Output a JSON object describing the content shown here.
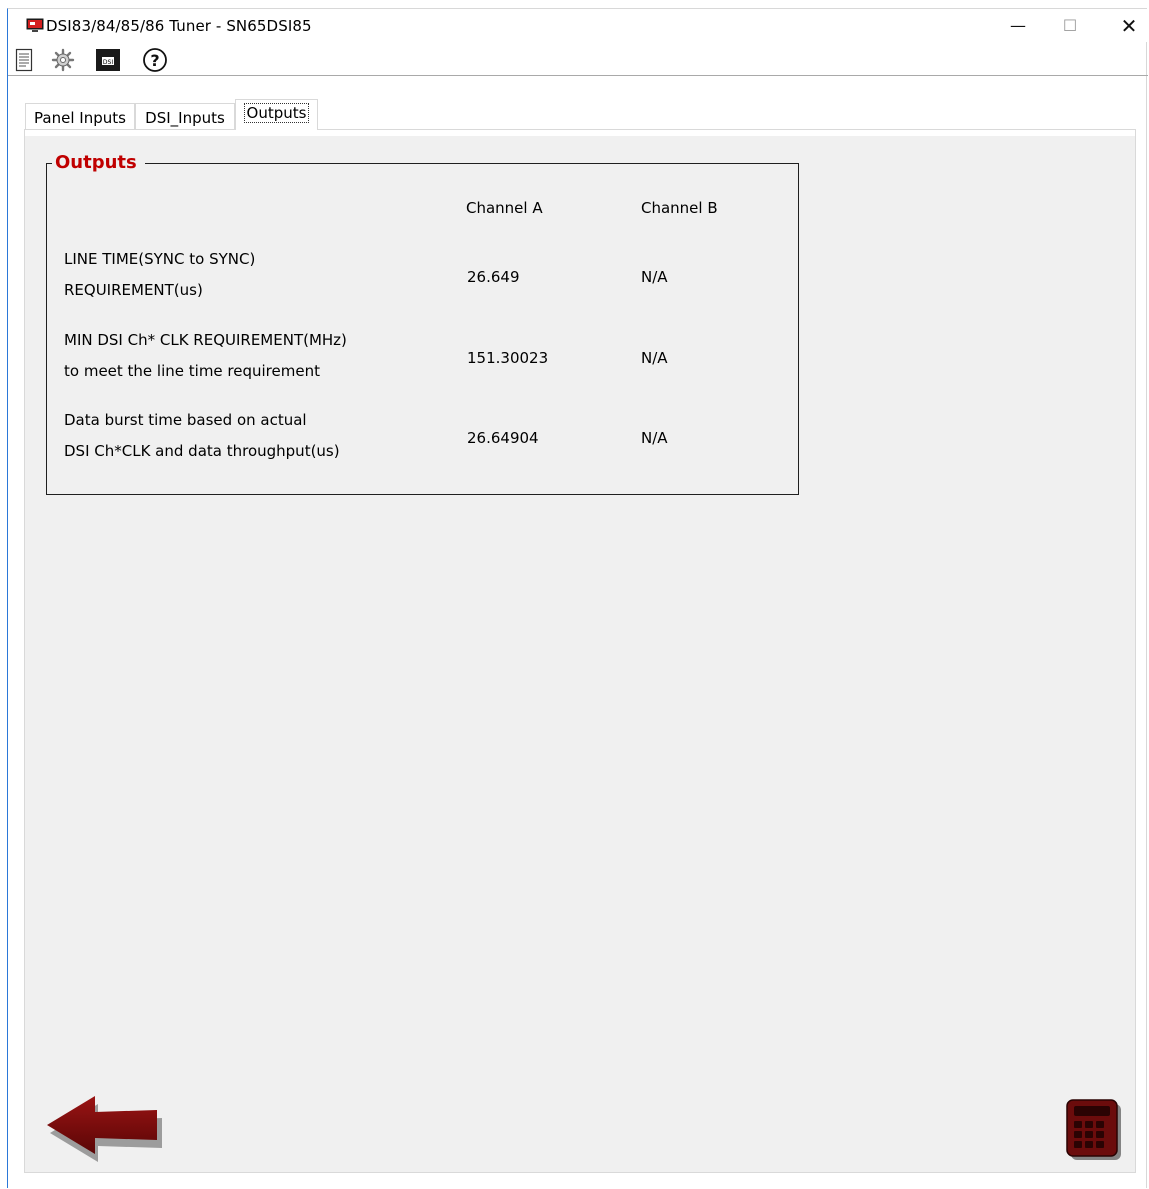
{
  "window": {
    "title": "DSI83/84/85/86 Tuner - SN65DSI85",
    "controls": {
      "minimize": "—",
      "maximize": "☐",
      "close": "✕"
    }
  },
  "toolbar": {
    "items": [
      {
        "name": "new-document",
        "icon": "document-icon"
      },
      {
        "name": "settings",
        "icon": "gear-icon"
      },
      {
        "name": "dsi",
        "icon": "dsi-icon",
        "label": "DSI"
      },
      {
        "name": "help",
        "icon": "help-icon",
        "label": "?"
      }
    ]
  },
  "tabs": [
    {
      "label": "Panel Inputs",
      "active": false
    },
    {
      "label": "DSI_Inputs",
      "active": false
    },
    {
      "label": "Outputs",
      "active": true
    }
  ],
  "outputs": {
    "title": "Outputs",
    "columns": [
      "Channel A",
      "Channel B"
    ],
    "rows": [
      {
        "label_line1": "LINE TIME(SYNC to SYNC)",
        "label_line2": "REQUIREMENT(us)",
        "channel_a": "26.649",
        "channel_b": "N/A"
      },
      {
        "label_line1": "MIN DSI Ch* CLK REQUIREMENT(MHz)",
        "label_line2": "to meet the line time requirement",
        "channel_a": "151.30023",
        "channel_b": "N/A"
      },
      {
        "label_line1": "Data burst time based on actual",
        "label_line2": "DSI Ch*CLK and data throughput(us)",
        "channel_a": "26.64904",
        "channel_b": "N/A"
      }
    ]
  },
  "bottom": {
    "back_icon": "back-arrow-icon",
    "calculate_icon": "calculator-icon"
  },
  "colors": {
    "accent_title": "#c00000",
    "arrow": "#7a0a0a",
    "calculator": "#5c0a0a",
    "page_bg": "#f0f0f0"
  }
}
